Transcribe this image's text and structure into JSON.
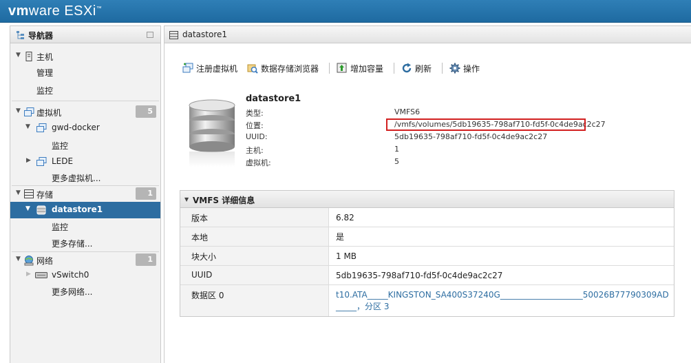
{
  "brand": {
    "vm": "vm",
    "ware": "ware",
    "product": "ESXi",
    "tm": "™"
  },
  "navigator": {
    "title": "导航器",
    "host": {
      "label": "主机",
      "children": [
        "管理",
        "监控"
      ]
    },
    "vms": {
      "label": "虚拟机",
      "count": "5",
      "items": [
        {
          "label": "gwd-docker",
          "children": [
            "监控"
          ]
        },
        {
          "label": "LEDE"
        }
      ],
      "more": "更多虚拟机..."
    },
    "storage": {
      "label": "存储",
      "count": "1",
      "selected": "datastore1",
      "children": [
        "监控"
      ],
      "more": "更多存储..."
    },
    "network": {
      "label": "网络",
      "count": "1",
      "items": [
        {
          "label": "vSwitch0"
        }
      ],
      "more": "更多网络..."
    }
  },
  "main": {
    "title": "datastore1",
    "toolbar": {
      "register_vm": "注册虚拟机",
      "browser": "数据存储浏览器",
      "increase": "增加容量",
      "refresh": "刷新",
      "actions": "操作"
    },
    "summary": {
      "name": "datastore1",
      "type_label": "类型:",
      "type_value": "VMFS6",
      "location_label": "位置:",
      "location_value": "/vmfs/volumes/5db19635-798af710-fd5f-0c4de9ac2c27",
      "uuid_label": "UUID:",
      "uuid_value": "5db19635-798af710-fd5f-0c4de9ac2c27",
      "hosts_label": "主机:",
      "hosts_value": "1",
      "vms_label": "虚拟机:",
      "vms_value": "5"
    },
    "details": {
      "title": "VMFS 详细信息",
      "rows": [
        {
          "key": "版本",
          "value": "6.82"
        },
        {
          "key": "本地",
          "value": "是"
        },
        {
          "key": "块大小",
          "value": "1 MB"
        },
        {
          "key": "UUID",
          "value": "5db19635-798af710-fd5f-0c4de9ac2c27"
        },
        {
          "key": "数据区 0",
          "value": "t10.ATA_____KINGSTON_SA400S37240G____________________50026B77790309AD_____，分区 3"
        }
      ]
    }
  },
  "colors": {
    "brand_bar": "#1e6aa1",
    "selection": "#2d6da1",
    "highlight_box": "#d21f1f",
    "link": "#2d6da1"
  }
}
